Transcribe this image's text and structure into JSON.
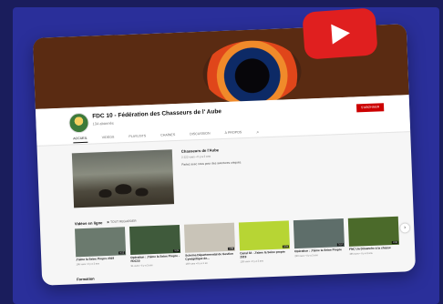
{
  "channel": {
    "name": "FDC 10 - Fédération des Chasseurs de l' Aube",
    "subscribers": "134 abonnés",
    "subscribe_label": "S'ABONNER"
  },
  "tabs": [
    "ACCUEIL",
    "VIDÉOS",
    "PLAYLISTS",
    "CHAÎNES",
    "DISCUSSION",
    "À PROPOS"
  ],
  "featured": {
    "title": "Chasseurs de l'Aube",
    "meta": "2 222 vues • Il y a 2 ans",
    "description": "Partez avec nous pour des aventures uniques."
  },
  "videos_section": {
    "title": "Vidéos en ligne",
    "play_all": "TOUT REGARDER"
  },
  "videos": [
    {
      "title": "J'aime la Seine Propre 2019",
      "meta": "196 vues • Il y a 3 ans",
      "duration": "4:12",
      "color": "#6b7a6e"
    },
    {
      "title": "Opération : J'aime la Seine Propre - FDC10",
      "meta": "91 vues • Il y a 3 ans",
      "duration": "3:25",
      "color": "#3f5a3b"
    },
    {
      "title": "Schéma Départemental de Gestion Cynégétique de...",
      "meta": "149 vues • Il y a 1 an",
      "duration": "1:58",
      "color": "#c9c4b8"
    },
    {
      "title": "Canal 32 - J'aime la Seine propre 2019",
      "meta": "130 vues • Il y a 3 ans",
      "duration": "2:04",
      "color": "#b7d534"
    },
    {
      "title": "Opération : J'aime la Seine Propre",
      "meta": "260 vues • Il y a 3 ans",
      "duration": "3:10",
      "color": "#5e6e6a"
    },
    {
      "title": "FNC Un Dimanche à la chasse",
      "meta": "196 vues • Il y a 3 ans",
      "duration": "2:32",
      "color": "#4b6a2a"
    }
  ],
  "bottom_section": "Formation"
}
